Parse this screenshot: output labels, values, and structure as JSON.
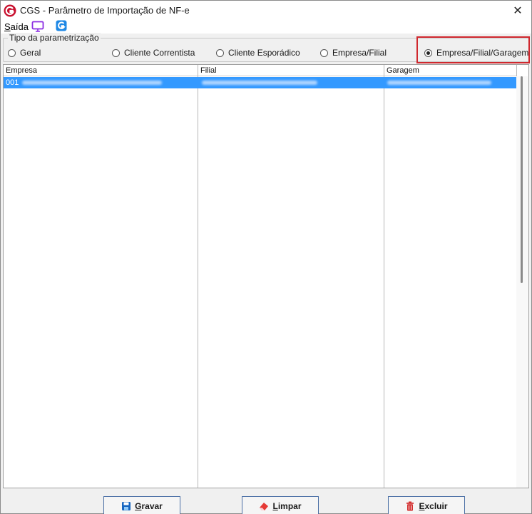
{
  "window": {
    "title": "CGS - Parâmetro de Importação de NF-e",
    "close_glyph": "✕"
  },
  "menu": {
    "saida_first": "S",
    "saida_rest": "aída",
    "icons": [
      "monitor-icon",
      "g-icon"
    ]
  },
  "param_group": {
    "legend": "Tipo da parametrização",
    "options": [
      {
        "label": "Geral",
        "checked": false
      },
      {
        "label": "Cliente Correntista",
        "checked": false
      },
      {
        "label": "Cliente Esporádico",
        "checked": false
      },
      {
        "label": "Empresa/Filial",
        "checked": false
      },
      {
        "label": "Empresa/Filial/Garagem",
        "checked": true
      }
    ]
  },
  "table": {
    "columns": [
      "Empresa",
      "Filial",
      "Garagem"
    ],
    "rows": [
      {
        "empresa_code": "001",
        "selected": true
      }
    ]
  },
  "buttons": {
    "gravar": {
      "first": "G",
      "rest": "ravar",
      "icon": "floppy-disk-icon"
    },
    "limpar": {
      "first": "L",
      "rest": "impar",
      "icon": "eraser-icon"
    },
    "excluir": {
      "first": "E",
      "rest": "xcluir",
      "icon": "trash-icon"
    }
  },
  "colors": {
    "selection": "#3399ff",
    "highlight": "#d0282e",
    "logo_red": "#c8102e",
    "g_icon_blue": "#1e88e5",
    "monitor_purple": "#8a2be2"
  }
}
